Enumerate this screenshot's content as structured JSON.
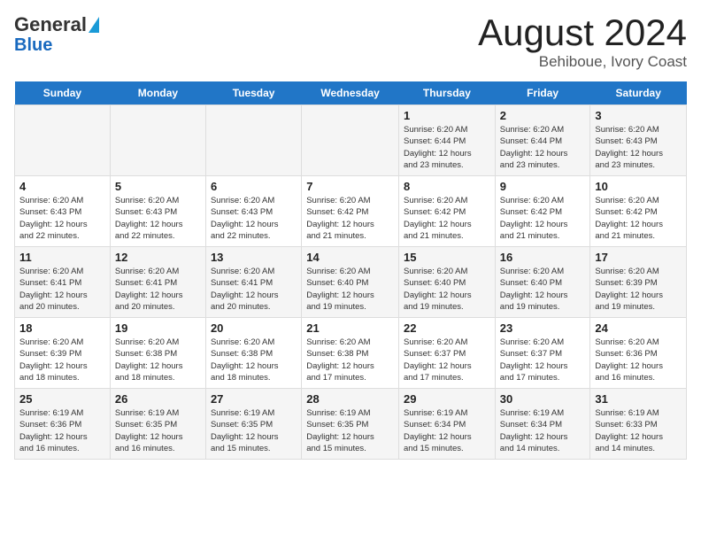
{
  "header": {
    "logo_line1": "General",
    "logo_line2": "Blue",
    "title": "August 2024",
    "subtitle": "Behiboue, Ivory Coast"
  },
  "weekdays": [
    "Sunday",
    "Monday",
    "Tuesday",
    "Wednesday",
    "Thursday",
    "Friday",
    "Saturday"
  ],
  "weeks": [
    [
      {
        "day": "",
        "info": ""
      },
      {
        "day": "",
        "info": ""
      },
      {
        "day": "",
        "info": ""
      },
      {
        "day": "",
        "info": ""
      },
      {
        "day": "1",
        "info": "Sunrise: 6:20 AM\nSunset: 6:44 PM\nDaylight: 12 hours\nand 23 minutes."
      },
      {
        "day": "2",
        "info": "Sunrise: 6:20 AM\nSunset: 6:44 PM\nDaylight: 12 hours\nand 23 minutes."
      },
      {
        "day": "3",
        "info": "Sunrise: 6:20 AM\nSunset: 6:43 PM\nDaylight: 12 hours\nand 23 minutes."
      }
    ],
    [
      {
        "day": "4",
        "info": "Sunrise: 6:20 AM\nSunset: 6:43 PM\nDaylight: 12 hours\nand 22 minutes."
      },
      {
        "day": "5",
        "info": "Sunrise: 6:20 AM\nSunset: 6:43 PM\nDaylight: 12 hours\nand 22 minutes."
      },
      {
        "day": "6",
        "info": "Sunrise: 6:20 AM\nSunset: 6:43 PM\nDaylight: 12 hours\nand 22 minutes."
      },
      {
        "day": "7",
        "info": "Sunrise: 6:20 AM\nSunset: 6:42 PM\nDaylight: 12 hours\nand 21 minutes."
      },
      {
        "day": "8",
        "info": "Sunrise: 6:20 AM\nSunset: 6:42 PM\nDaylight: 12 hours\nand 21 minutes."
      },
      {
        "day": "9",
        "info": "Sunrise: 6:20 AM\nSunset: 6:42 PM\nDaylight: 12 hours\nand 21 minutes."
      },
      {
        "day": "10",
        "info": "Sunrise: 6:20 AM\nSunset: 6:42 PM\nDaylight: 12 hours\nand 21 minutes."
      }
    ],
    [
      {
        "day": "11",
        "info": "Sunrise: 6:20 AM\nSunset: 6:41 PM\nDaylight: 12 hours\nand 20 minutes."
      },
      {
        "day": "12",
        "info": "Sunrise: 6:20 AM\nSunset: 6:41 PM\nDaylight: 12 hours\nand 20 minutes."
      },
      {
        "day": "13",
        "info": "Sunrise: 6:20 AM\nSunset: 6:41 PM\nDaylight: 12 hours\nand 20 minutes."
      },
      {
        "day": "14",
        "info": "Sunrise: 6:20 AM\nSunset: 6:40 PM\nDaylight: 12 hours\nand 19 minutes."
      },
      {
        "day": "15",
        "info": "Sunrise: 6:20 AM\nSunset: 6:40 PM\nDaylight: 12 hours\nand 19 minutes."
      },
      {
        "day": "16",
        "info": "Sunrise: 6:20 AM\nSunset: 6:40 PM\nDaylight: 12 hours\nand 19 minutes."
      },
      {
        "day": "17",
        "info": "Sunrise: 6:20 AM\nSunset: 6:39 PM\nDaylight: 12 hours\nand 19 minutes."
      }
    ],
    [
      {
        "day": "18",
        "info": "Sunrise: 6:20 AM\nSunset: 6:39 PM\nDaylight: 12 hours\nand 18 minutes."
      },
      {
        "day": "19",
        "info": "Sunrise: 6:20 AM\nSunset: 6:38 PM\nDaylight: 12 hours\nand 18 minutes."
      },
      {
        "day": "20",
        "info": "Sunrise: 6:20 AM\nSunset: 6:38 PM\nDaylight: 12 hours\nand 18 minutes."
      },
      {
        "day": "21",
        "info": "Sunrise: 6:20 AM\nSunset: 6:38 PM\nDaylight: 12 hours\nand 17 minutes."
      },
      {
        "day": "22",
        "info": "Sunrise: 6:20 AM\nSunset: 6:37 PM\nDaylight: 12 hours\nand 17 minutes."
      },
      {
        "day": "23",
        "info": "Sunrise: 6:20 AM\nSunset: 6:37 PM\nDaylight: 12 hours\nand 17 minutes."
      },
      {
        "day": "24",
        "info": "Sunrise: 6:20 AM\nSunset: 6:36 PM\nDaylight: 12 hours\nand 16 minutes."
      }
    ],
    [
      {
        "day": "25",
        "info": "Sunrise: 6:19 AM\nSunset: 6:36 PM\nDaylight: 12 hours\nand 16 minutes."
      },
      {
        "day": "26",
        "info": "Sunrise: 6:19 AM\nSunset: 6:35 PM\nDaylight: 12 hours\nand 16 minutes."
      },
      {
        "day": "27",
        "info": "Sunrise: 6:19 AM\nSunset: 6:35 PM\nDaylight: 12 hours\nand 15 minutes."
      },
      {
        "day": "28",
        "info": "Sunrise: 6:19 AM\nSunset: 6:35 PM\nDaylight: 12 hours\nand 15 minutes."
      },
      {
        "day": "29",
        "info": "Sunrise: 6:19 AM\nSunset: 6:34 PM\nDaylight: 12 hours\nand 15 minutes."
      },
      {
        "day": "30",
        "info": "Sunrise: 6:19 AM\nSunset: 6:34 PM\nDaylight: 12 hours\nand 14 minutes."
      },
      {
        "day": "31",
        "info": "Sunrise: 6:19 AM\nSunset: 6:33 PM\nDaylight: 12 hours\nand 14 minutes."
      }
    ]
  ]
}
